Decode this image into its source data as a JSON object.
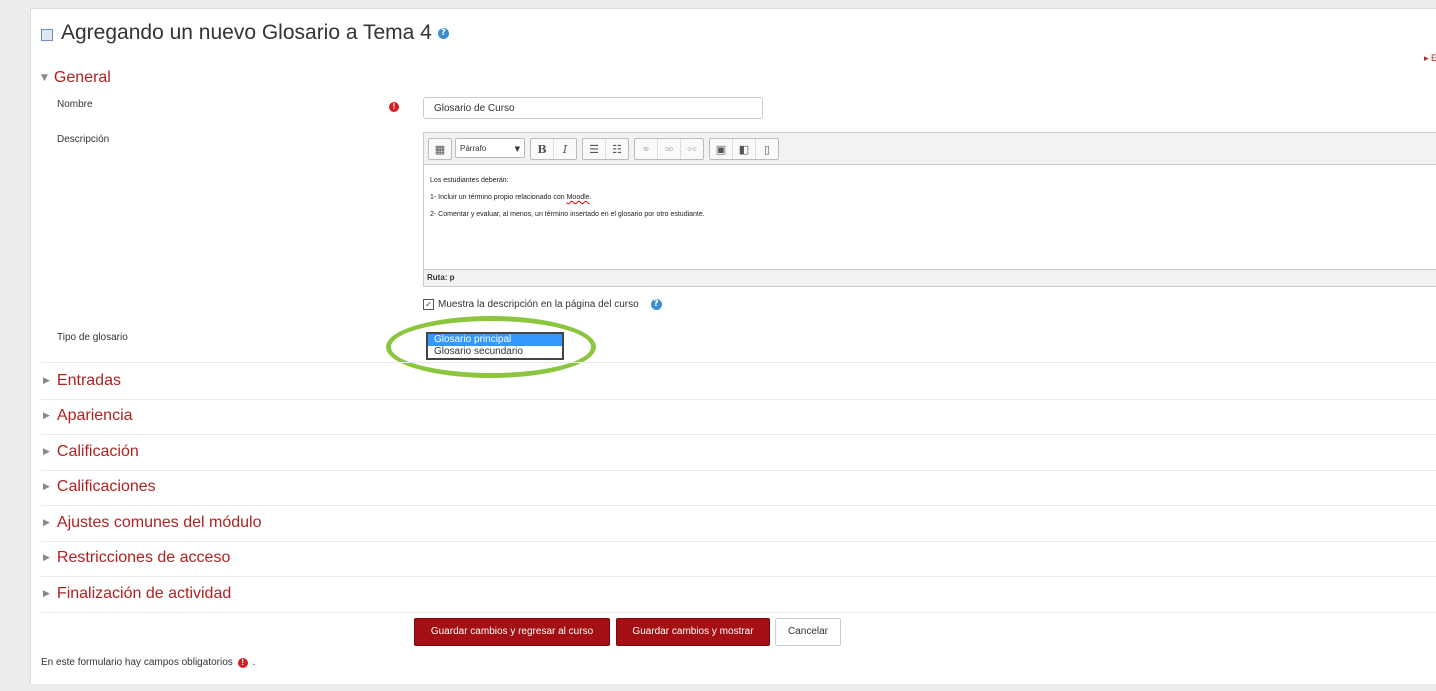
{
  "page": {
    "title": "Agregando un nuevo Glosario a Tema 4",
    "expand_all": "▸ E"
  },
  "general": {
    "heading": "General",
    "name_label": "Nombre",
    "name_value": "Glosario de Curso",
    "desc_label": "Descripción",
    "editor": {
      "format_select": "Párrafo",
      "lines": [
        "Los estudiantes deberán:",
        "1- Incluir un término propio relacionado con",
        "Moodle",
        ".",
        "2- Comentar y evaluar, al menos, un término insertado en el glosario por otro estudiante."
      ],
      "path": "Ruta: p"
    },
    "show_desc_label": "Muestra la descripción en la página del curso",
    "show_desc_checked": true,
    "type_label": "Tipo de glosario",
    "type_options": [
      "Glosario principal",
      "Glosario secundario"
    ],
    "type_selected": "Glosario principal"
  },
  "sections": [
    "Entradas",
    "Apariencia",
    "Calificación",
    "Calificaciones",
    "Ajustes comunes del módulo",
    "Restricciones de acceso",
    "Finalización de actividad"
  ],
  "buttons": {
    "save_return": "Guardar cambios y regresar al curso",
    "save_show": "Guardar cambios y mostrar",
    "cancel": "Cancelar"
  },
  "footer": {
    "required_note": "En este formulario hay campos obligatorios",
    "required_suffix": "."
  },
  "colors": {
    "accent": "#b02222",
    "button": "#a30f12",
    "highlight_ellipse": "#8cc63f",
    "selection": "#3399ff"
  }
}
